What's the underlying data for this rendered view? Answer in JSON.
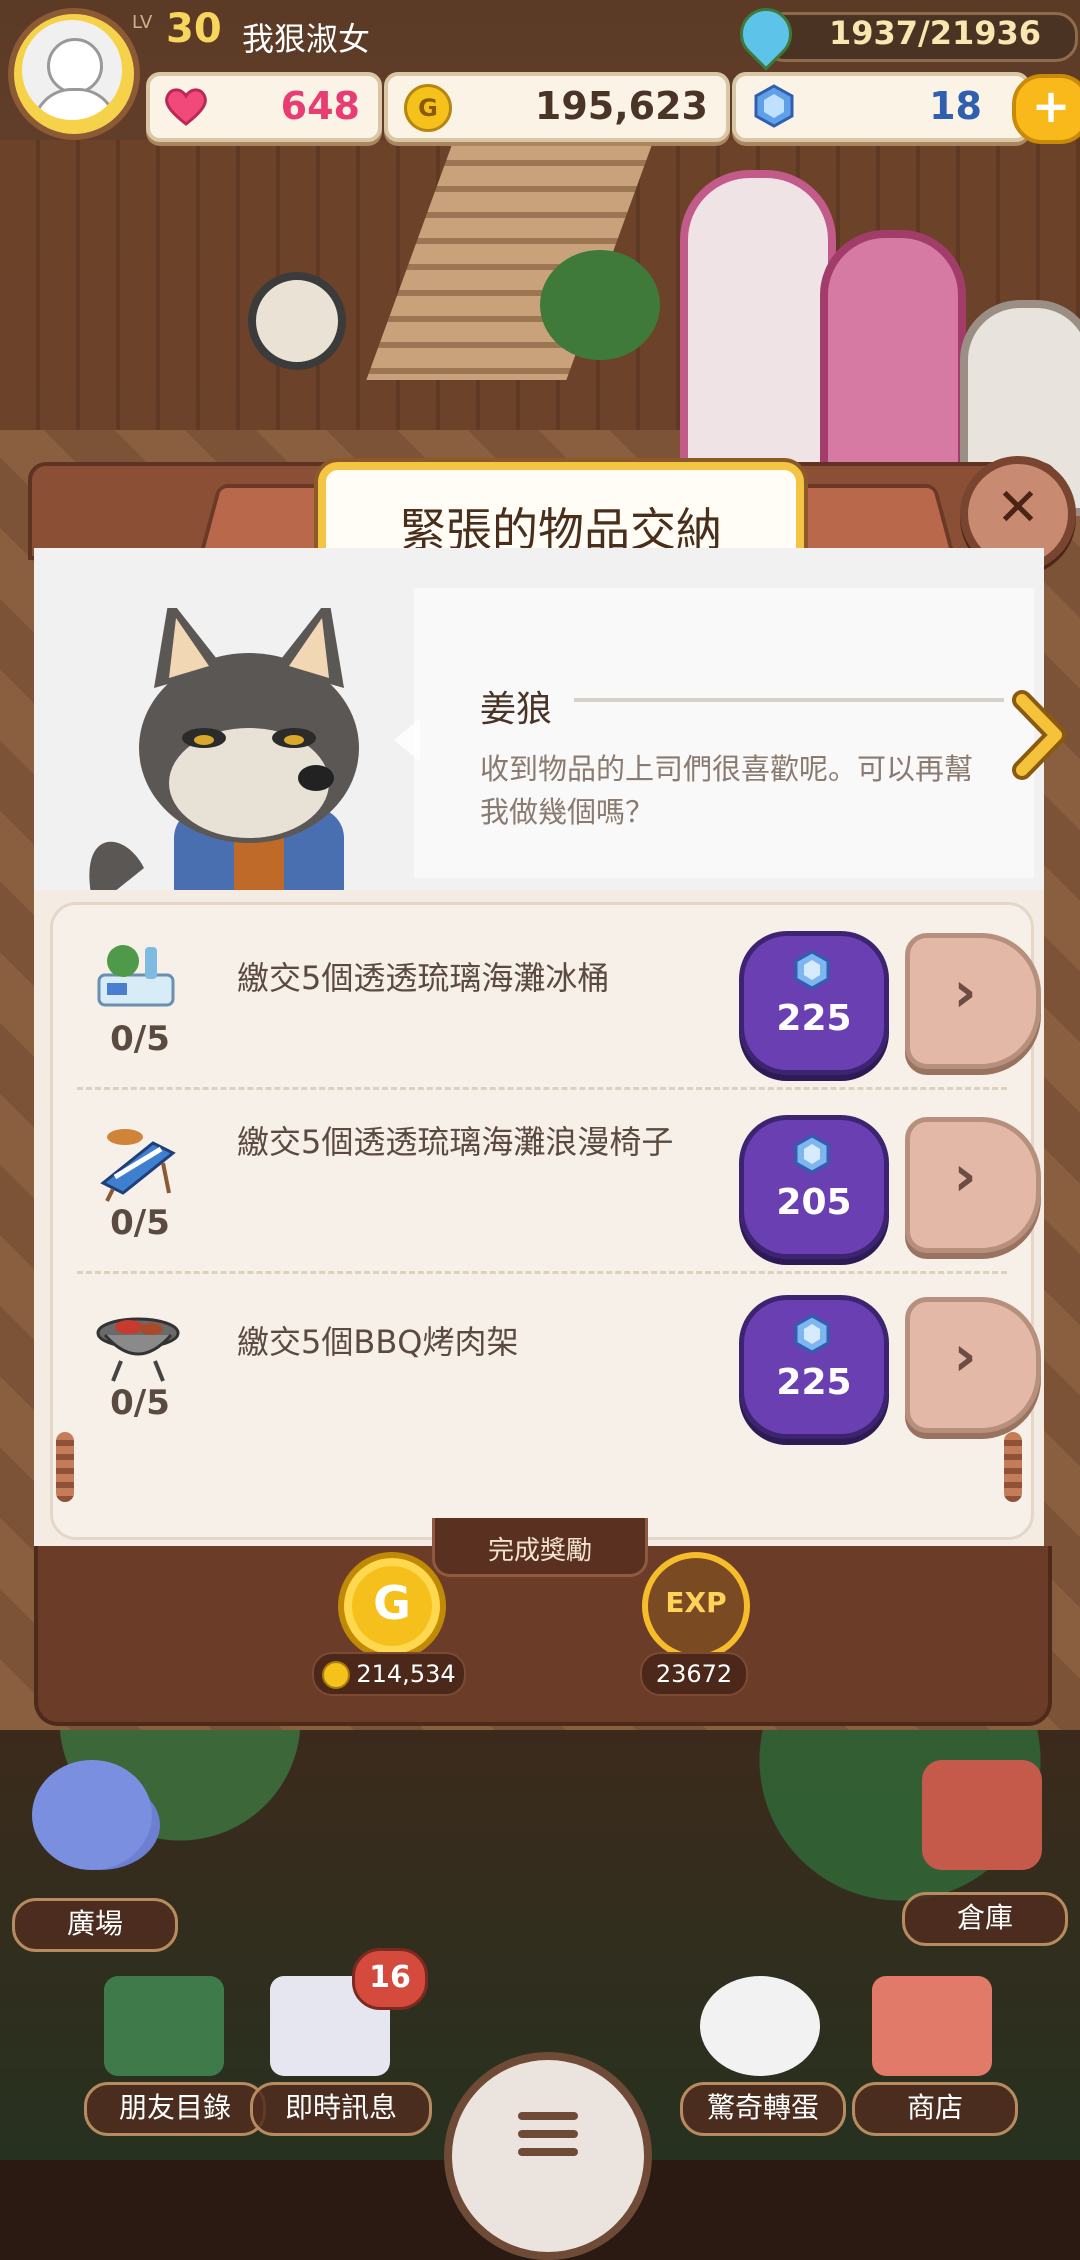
{
  "player": {
    "level_label": "LV",
    "level": "30",
    "name": "我狠淑女",
    "exp": "1937/21936",
    "hearts": "648",
    "coins": "195,623",
    "gems": "18"
  },
  "dialog": {
    "title": "緊張的物品交納",
    "close_symbol": "✕",
    "speaker": "姜狼",
    "message": "收到物品的上司們很喜歡呢。可以再幫我做幾個嗎？",
    "tasks": [
      {
        "desc": "繳交5個透透琉璃海灘冰桶",
        "progress": "0/5",
        "cost": "225",
        "icon": "ice-bucket-icon"
      },
      {
        "desc": "繳交5個透透琉璃海灘浪漫椅子",
        "progress": "0/5",
        "cost": "205",
        "icon": "beach-chair-icon"
      },
      {
        "desc": "繳交5個BBQ烤肉架",
        "progress": "0/5",
        "cost": "225",
        "icon": "bbq-grill-icon"
      }
    ],
    "reward_title": "完成獎勵",
    "reward_coin_letter": "G",
    "reward_coin_value": "214,534",
    "reward_exp_label": "EXP",
    "reward_exp_value": "23672"
  },
  "nav": {
    "plaza": "廣場",
    "warehouse": "倉庫",
    "friends": "朋友目錄",
    "messages": "即時訊息",
    "messages_badge": "16",
    "gacha": "驚奇轉蛋",
    "shop": "商店"
  },
  "colors": {
    "gem_button": "#6a3fb2",
    "title_border": "#f4c543",
    "dialog_frame": "#8b4f35"
  }
}
